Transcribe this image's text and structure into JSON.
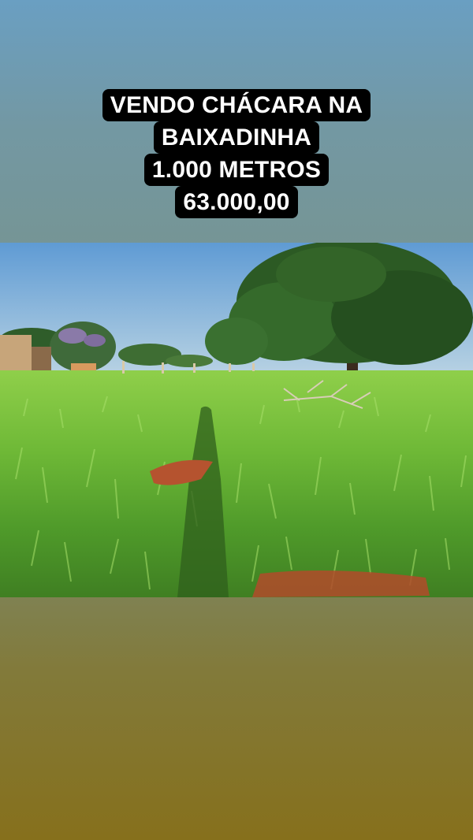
{
  "caption": {
    "lines": [
      "VENDO CHÁCARA NA",
      "BAIXADINHA",
      "1.000 METROS",
      "63.000,00"
    ]
  },
  "photo": {
    "subject": "grass-field-with-tree"
  },
  "colors": {
    "caption_bg": "#000000",
    "caption_text": "#ffffff",
    "bg_top": "#6a9fc2",
    "bg_bottom": "#86701c"
  }
}
